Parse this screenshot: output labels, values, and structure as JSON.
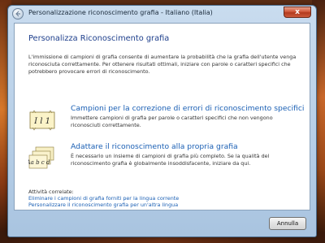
{
  "window": {
    "title": "Personalizzazione riconoscimento grafia - Italiano (Italia)",
    "close_label": "x"
  },
  "main": {
    "heading": "Personalizza Riconoscimento grafia",
    "intro": "L'immissione di campioni di grafia consente di aumentare la probabilità che la grafia dell'utente venga riconosciuta correttamente. Per ottenere risultati ottimali, iniziare con parole o caratteri specifici che potrebbero provocare errori di riconoscimento.",
    "options": [
      {
        "title": "Campioni per la correzione di errori di riconoscimento specifici",
        "description": "Immettere campioni di grafia per parole o caratteri specifici che non vengono riconosciuti correttamente.",
        "icon": "handwriting-target-icon",
        "icon_text": "I l 1"
      },
      {
        "title": "Adattare il riconoscimento alla propria grafia",
        "description": "È necessario un insieme di campioni di grafia più completo. Se la qualità del riconoscimento grafia è globalmente insoddisfacente, iniziare da qui.",
        "icon": "handwriting-sheets-icon",
        "icon_text": "Aa b c d"
      }
    ],
    "related": {
      "label": "Attività correlate:",
      "links": [
        "Eliminare i campioni di grafia forniti per la lingua corrente",
        "Personalizzare il riconoscimento grafia per un'altra lingua"
      ]
    }
  },
  "footer": {
    "cancel_label": "Annulla"
  },
  "colors": {
    "link": "#1a5fb4",
    "heading": "#1e3f8c",
    "close": "#c8462a"
  }
}
